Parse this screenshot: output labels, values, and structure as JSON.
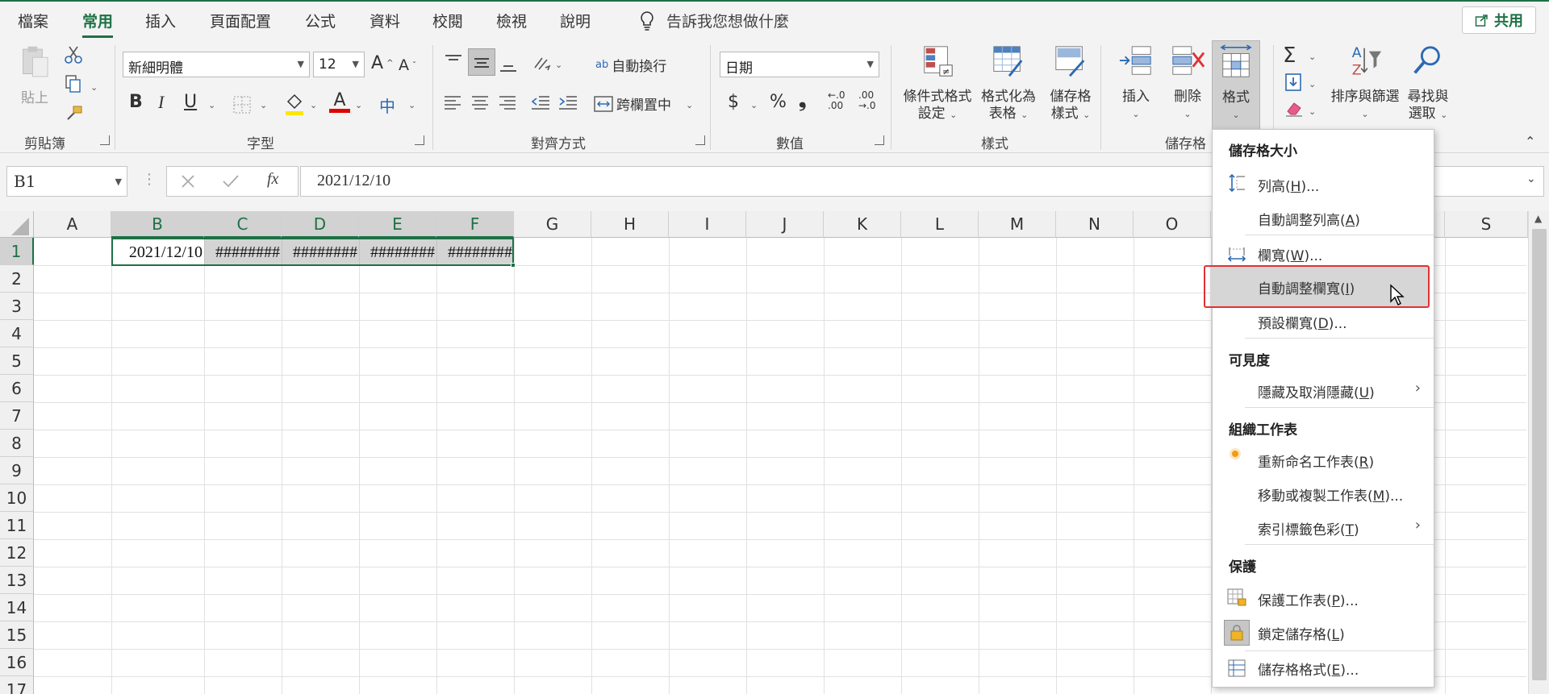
{
  "tabs": [
    "檔案",
    "常用",
    "插入",
    "頁面配置",
    "公式",
    "資料",
    "校閱",
    "檢視",
    "說明"
  ],
  "tellme": "告訴我您想做什麼",
  "share": "共用",
  "ribbon": {
    "clipboard": {
      "label": "剪貼簿",
      "paste": "貼上"
    },
    "font": {
      "label": "字型",
      "name": "新細明體",
      "size": "12",
      "bold": "B",
      "italic": "I",
      "underline": "U",
      "grow": "A",
      "shrink": "A",
      "color_a": "A",
      "phonetic": "中"
    },
    "align": {
      "label": "對齊方式",
      "wrap": "自動換行",
      "merge": "跨欄置中",
      "ab": "ab"
    },
    "number": {
      "label": "數值",
      "format": "日期",
      "currency": "$",
      "percent": "%",
      "comma": "❟",
      "inc": "←.0\n.00",
      "dec": ".00\n→.0"
    },
    "styles": {
      "label": "樣式",
      "cond": [
        "條件式格式",
        "設定"
      ],
      "table": [
        "格式化為",
        "表格"
      ],
      "cell": [
        "儲存格",
        "樣式"
      ]
    },
    "cells": {
      "label": "儲存格",
      "insert": "插入",
      "delete": "刪除",
      "format": "格式"
    },
    "editing": {
      "sigma": "Σ",
      "sort": [
        "排序與篩選"
      ],
      "find": [
        "尋找與",
        "選取"
      ]
    }
  },
  "formula_bar": {
    "name_box": "B1",
    "fx": "fx",
    "formula": "2021/12/10"
  },
  "grid": {
    "columns": [
      "A",
      "B",
      "C",
      "D",
      "E",
      "F",
      "G",
      "H",
      "I",
      "J",
      "K",
      "L",
      "M",
      "N",
      "O",
      "S"
    ],
    "rows": [
      "1",
      "2",
      "3",
      "4",
      "5",
      "6",
      "7",
      "8",
      "9",
      "10",
      "11",
      "12",
      "13",
      "14",
      "15",
      "16",
      "17"
    ],
    "cells": [
      {
        "col": "B",
        "value": "2021/12/10"
      },
      {
        "col": "C",
        "value": "########"
      },
      {
        "col": "D",
        "value": "########"
      },
      {
        "col": "E",
        "value": "########"
      },
      {
        "col": "F",
        "value": "########"
      }
    ]
  },
  "menu": {
    "sections": [
      "儲存格大小",
      "可見度",
      "組織工作表",
      "保護"
    ],
    "items": [
      {
        "label": "列高(",
        "key": "H",
        "tail": ")..."
      },
      {
        "label": "自動調整列高(",
        "key": "A",
        "tail": ")"
      },
      {
        "label": "欄寬(",
        "key": "W",
        "tail": ")..."
      },
      {
        "label": "自動調整欄寬(",
        "key": "I",
        "tail": ")"
      },
      {
        "label": "預設欄寬(",
        "key": "D",
        "tail": ")..."
      },
      {
        "label": "隱藏及取消隱藏(",
        "key": "U",
        "tail": ")"
      },
      {
        "label": "重新命名工作表(",
        "key": "R",
        "tail": ")"
      },
      {
        "label": "移動或複製工作表(",
        "key": "M",
        "tail": ")..."
      },
      {
        "label": "索引標籤色彩(",
        "key": "T",
        "tail": ")"
      },
      {
        "label": "保護工作表(",
        "key": "P",
        "tail": ")..."
      },
      {
        "label": "鎖定儲存格(",
        "key": "L",
        "tail": ")"
      },
      {
        "label": "儲存格格式(",
        "key": "E",
        "tail": ")..."
      }
    ]
  },
  "colors": {
    "accent": "#1e7145",
    "highlight": "#e03232",
    "fill_yellow": "#ffe600",
    "font_red": "#e00000"
  }
}
